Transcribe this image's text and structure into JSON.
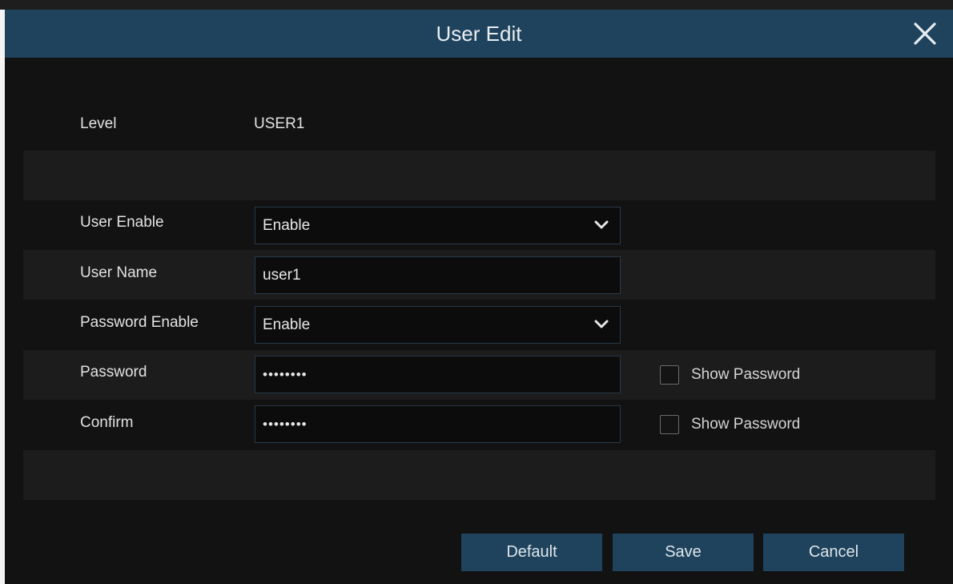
{
  "dialog": {
    "title": "User Edit",
    "close_icon": "close-icon"
  },
  "level": {
    "label": "Level",
    "value": "USER1"
  },
  "user_enable": {
    "label": "User Enable",
    "selected": "Enable",
    "icon": "chevron-down-icon"
  },
  "user_name": {
    "label": "User Name",
    "value": "user1"
  },
  "password_enable": {
    "label": "Password Enable",
    "selected": "Enable",
    "icon": "chevron-down-icon"
  },
  "password": {
    "label": "Password",
    "masked_value": "••••••••",
    "show_password_label": "Show Password",
    "show_password_checked": false
  },
  "confirm": {
    "label": "Confirm",
    "masked_value": "••••••••",
    "show_password_label": "Show Password",
    "show_password_checked": false
  },
  "buttons": {
    "default_label": "Default",
    "save_label": "Save",
    "cancel_label": "Cancel"
  },
  "colors": {
    "titlebar": "#1f435c",
    "dialog_bg": "#121212",
    "row_shade": "#1c1c1c",
    "button_bg": "#1f435c"
  }
}
